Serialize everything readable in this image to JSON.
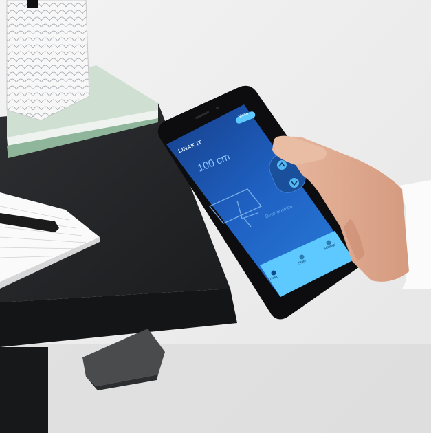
{
  "phone_app": {
    "title": "LINAK IT",
    "height_value": "100 cm",
    "header_pill": "Menu",
    "status_text": "Desk position",
    "up_icon": "chevron-up-icon",
    "down_icon": "chevron-down-icon",
    "nav": [
      {
        "icon": "desk-icon",
        "label": "Desk"
      },
      {
        "icon": "stats-icon",
        "label": "Stats"
      },
      {
        "icon": "settings-icon",
        "label": "Settings"
      }
    ]
  },
  "colors": {
    "wall": "#efefef",
    "desk": "#222426",
    "screen": "#1f5fc0",
    "screen_dark": "#163f8a",
    "accent": "#5ec9ff"
  }
}
